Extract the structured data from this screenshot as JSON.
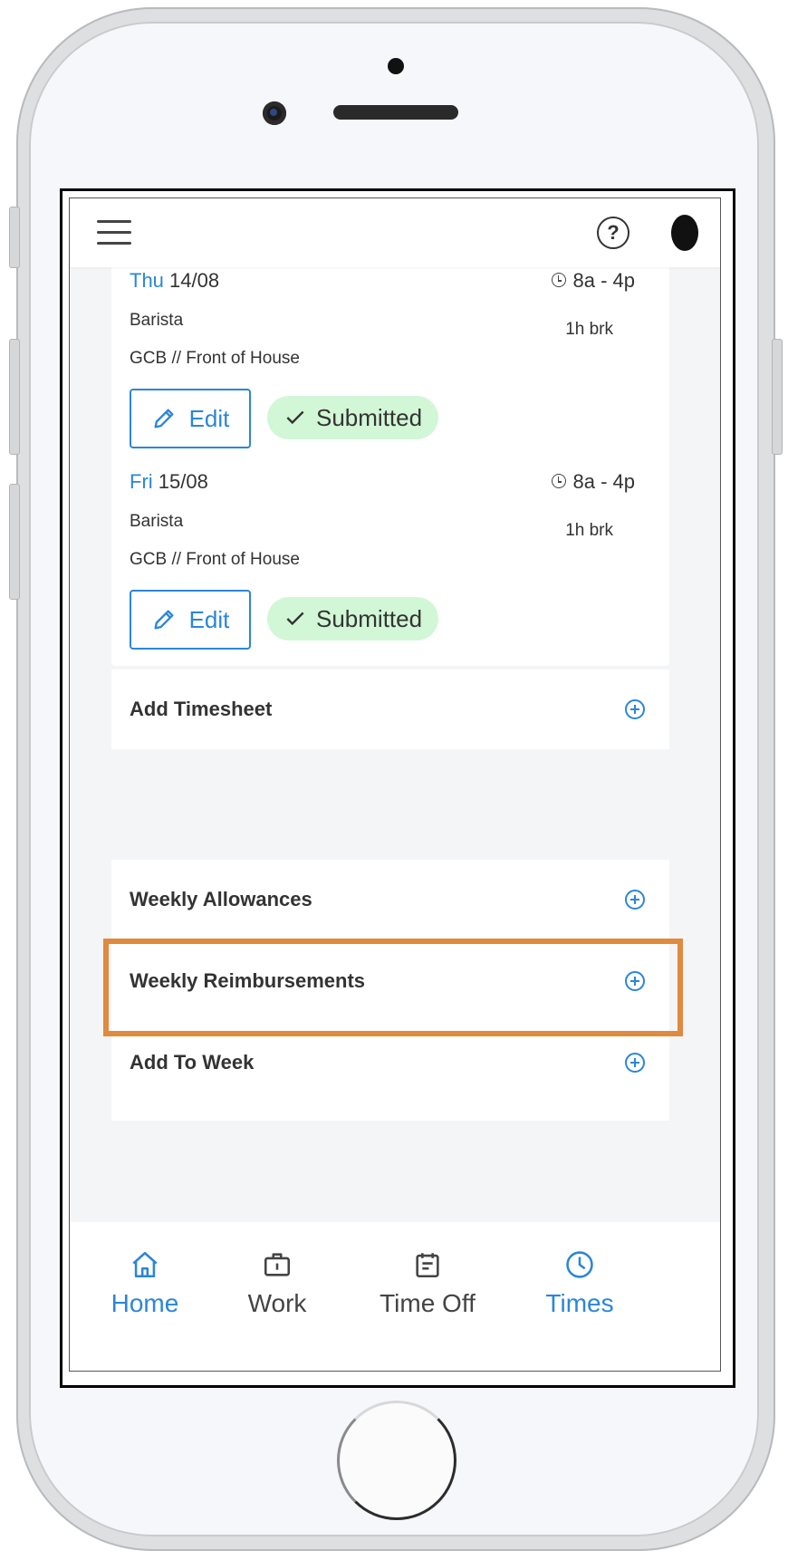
{
  "header": {
    "menu_icon": "hamburger-menu-icon",
    "help_icon": "help-question-icon",
    "help_glyph": "?",
    "avatar": "user-avatar"
  },
  "shifts": [
    {
      "dow": "Thu",
      "date": "14/08",
      "time": "8a - 4p",
      "role": "Barista",
      "break": "1h brk",
      "location": "GCB // Front of House",
      "edit_label": "Edit",
      "status": "Submitted"
    },
    {
      "dow": "Fri",
      "date": "15/08",
      "time": "8a - 4p",
      "role": "Barista",
      "break": "1h brk",
      "location": "GCB // Front of House",
      "edit_label": "Edit",
      "status": "Submitted"
    }
  ],
  "add_timesheet": {
    "label": "Add Timesheet"
  },
  "week_actions": [
    {
      "label": "Weekly Allowances"
    },
    {
      "label": "Weekly Reimbursements",
      "highlighted": true
    },
    {
      "label": "Add To Week"
    }
  ],
  "tabs": [
    {
      "label": "Home",
      "icon": "home-icon",
      "active": true
    },
    {
      "label": "Work",
      "icon": "briefcase-icon",
      "active": false
    },
    {
      "label": "Time Off",
      "icon": "calendar-icon",
      "active": false
    },
    {
      "label": "Times",
      "icon": "clock-icon",
      "active": true
    }
  ],
  "colors": {
    "accent": "#2b86d8",
    "submitted_bg": "#d2f7d6",
    "highlight": "#e08a3e",
    "text": "#333333"
  }
}
